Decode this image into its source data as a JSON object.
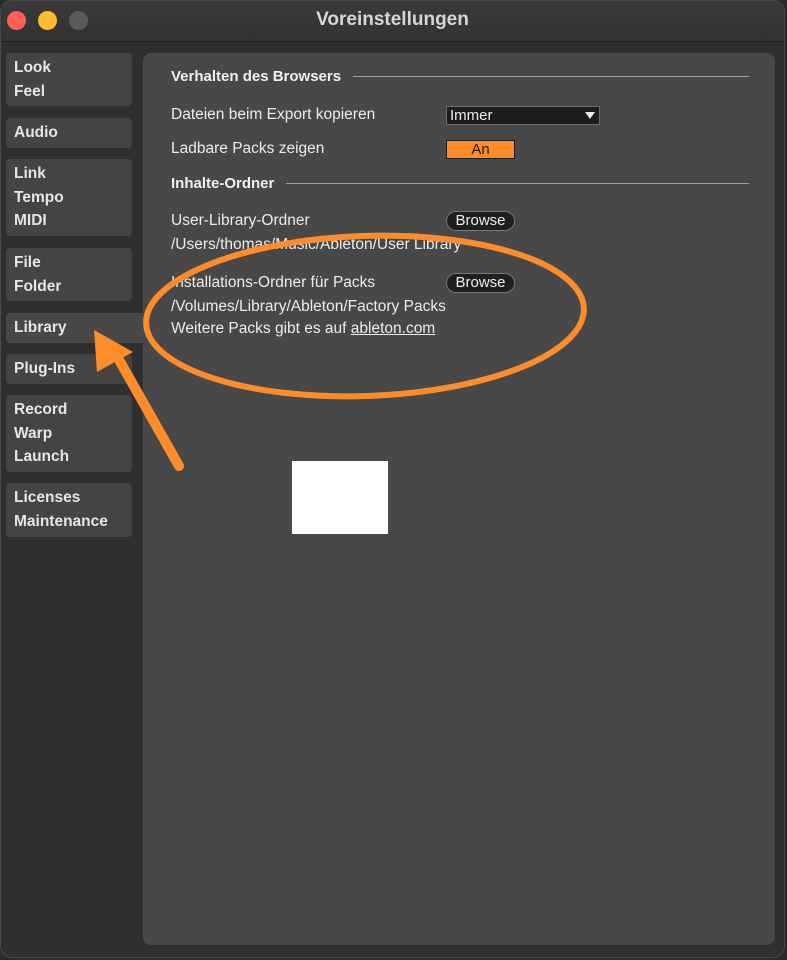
{
  "window": {
    "title": "Voreinstellungen"
  },
  "sidebar": {
    "items": [
      {
        "lines": [
          "Look",
          "Feel"
        ]
      },
      {
        "lines": [
          "Audio"
        ]
      },
      {
        "lines": [
          "Link",
          "Tempo",
          "MIDI"
        ]
      },
      {
        "lines": [
          "File",
          "Folder"
        ]
      },
      {
        "lines": [
          "Library"
        ],
        "active": true
      },
      {
        "lines": [
          "Plug-Ins"
        ]
      },
      {
        "lines": [
          "Record",
          "Warp",
          "Launch"
        ]
      },
      {
        "lines": [
          "Licenses",
          "Maintenance"
        ]
      }
    ]
  },
  "main": {
    "browser_section": {
      "header": "Verhalten des Browsers",
      "export_copy_label": "Dateien beim Export kopieren",
      "export_copy_value": "Immer",
      "show_packs_label": "Ladbare Packs zeigen",
      "show_packs_value": "An"
    },
    "content_section": {
      "header": "Inhalte-Ordner",
      "user_library_label": "User-Library-Ordner",
      "user_library_button": "Browse",
      "user_library_path": "/Users/thomas/Music/Ableton/User Library",
      "packs_label": "Installations-Ordner für Packs",
      "packs_button": "Browse",
      "packs_path": "/Volumes/Library/Ableton/Factory Packs",
      "more_packs_text": "Weitere Packs gibt es auf ",
      "more_packs_link": "ableton.com"
    }
  },
  "colors": {
    "accent": "#ff8c2a",
    "annotation": "#ff8c2a",
    "panel_bg": "#484848",
    "window_bg": "#2f2f2f"
  }
}
